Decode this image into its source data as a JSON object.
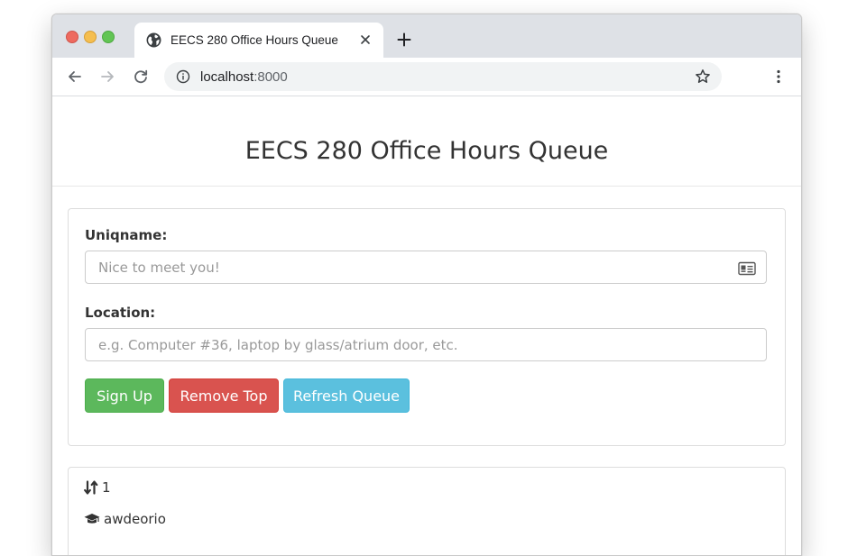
{
  "browser": {
    "tab_title": "EECS 280 Office Hours Queue",
    "url_host": "localhost",
    "url_port": ":8000"
  },
  "page": {
    "title": "EECS 280 Office Hours Queue"
  },
  "form": {
    "uniqname_label": "Uniqname:",
    "uniqname_placeholder": "Nice to meet you!",
    "location_label": "Location:",
    "location_placeholder": "e.g. Computer #36, laptop by glass/atrium door, etc.",
    "signup_label": "Sign Up",
    "remove_label": "Remove Top",
    "refresh_label": "Refresh Queue"
  },
  "queue": {
    "position": "1",
    "uniqname": "awdeorio"
  },
  "colors": {
    "success": "#5cb85c",
    "danger": "#d9534f",
    "info": "#5bc0de"
  },
  "icons": [
    "globe-icon",
    "close-icon",
    "plus-icon",
    "back-icon",
    "forward-icon",
    "reload-icon",
    "info-icon",
    "star-icon",
    "menu-icon",
    "id-card-icon",
    "sort-icon",
    "graduation-cap-icon"
  ]
}
